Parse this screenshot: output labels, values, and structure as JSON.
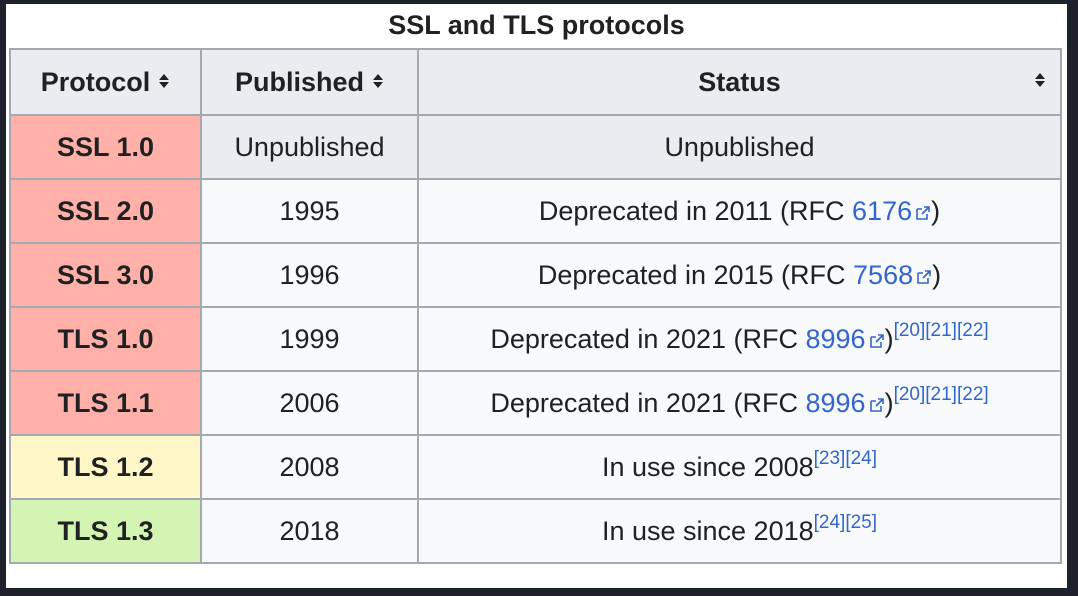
{
  "caption": "SSL and TLS protocols",
  "columns": [
    {
      "label": "Protocol",
      "sortable": true
    },
    {
      "label": "Published",
      "sortable": true
    },
    {
      "label": "Status",
      "sortable": true
    }
  ],
  "colors": {
    "insecure": "#ffb0a8",
    "partial": "#fff7c8",
    "secure": "#d4f4b4",
    "link": "#3366cc"
  },
  "rows": [
    {
      "protocol": "SSL 1.0",
      "published": "Unpublished",
      "status_text": "Unpublished",
      "rfc": null,
      "refs": [],
      "color": "#ffb0a8"
    },
    {
      "protocol": "SSL 2.0",
      "published": "1995",
      "status_text": "Deprecated in 2011 (RFC ",
      "rfc": "6176",
      "status_suffix": ")",
      "refs": [],
      "color": "#ffb0a8"
    },
    {
      "protocol": "SSL 3.0",
      "published": "1996",
      "status_text": "Deprecated in 2015 (RFC ",
      "rfc": "7568",
      "status_suffix": ")",
      "refs": [],
      "color": "#ffb0a8"
    },
    {
      "protocol": "TLS 1.0",
      "published": "1999",
      "status_text": "Deprecated in 2021 (RFC ",
      "rfc": "8996",
      "status_suffix": ")",
      "refs": [
        "[20]",
        "[21]",
        "[22]"
      ],
      "color": "#ffb0a8"
    },
    {
      "protocol": "TLS 1.1",
      "published": "2006",
      "status_text": "Deprecated in 2021 (RFC ",
      "rfc": "8996",
      "status_suffix": ")",
      "refs": [
        "[20]",
        "[21]",
        "[22]"
      ],
      "color": "#ffb0a8"
    },
    {
      "protocol": "TLS 1.2",
      "published": "2008",
      "status_text": "In use since 2008",
      "rfc": null,
      "refs": [
        "[23]",
        "[24]"
      ],
      "color": "#fff7c8"
    },
    {
      "protocol": "TLS 1.3",
      "published": "2018",
      "status_text": "In use since 2018",
      "rfc": null,
      "refs": [
        "[24]",
        "[25]"
      ],
      "color": "#d4f4b4"
    }
  ]
}
